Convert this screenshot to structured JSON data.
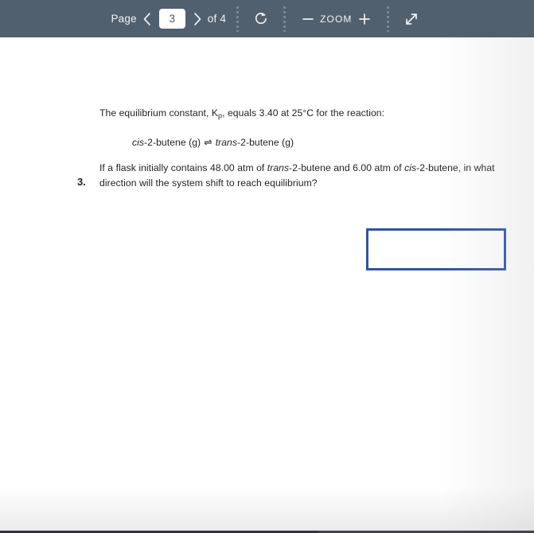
{
  "toolbar": {
    "page_label": "Page",
    "prev_icon": "chevron-left-icon",
    "page_value": "3",
    "next_icon": "chevron-right-icon",
    "of_label": "of 4",
    "total_pages": "4",
    "rotate_icon": "rotate-clockwise-icon",
    "zoom_out_label": "—",
    "zoom_label": "ZOOM",
    "zoom_in_label": "+",
    "fullscreen_icon": "expand-diagonal-icon",
    "background_color": "#51606e",
    "text_color": "#f2f4f6"
  },
  "document": {
    "question_number": "3.",
    "stem": {
      "part1": "The equilibrium constant, K",
      "subscript": "p",
      "part2": ", equals 3.40 at 25°C for the reaction:"
    },
    "reaction": {
      "reactant_prefix": "cis",
      "reactant_rest": "-2-butene (g)",
      "arrow": "⇌",
      "product_prefix": "trans",
      "product_rest": "-2-butene (g)"
    },
    "question": {
      "line1_a": "If a flask initially contains 48.00 atm of ",
      "line1_italic1": "trans",
      "line1_b": "-2-butene and 6.00 atm of ",
      "line1_italic2": "cis",
      "line1_c": "-2-butene, in what",
      "line2": "direction will the system shift to reach equilibrium?"
    },
    "answer_box": {
      "value": "",
      "placeholder": "",
      "border_color": "#2f54a4"
    },
    "background_color": "#ffffff",
    "text_color": "#231f20"
  }
}
